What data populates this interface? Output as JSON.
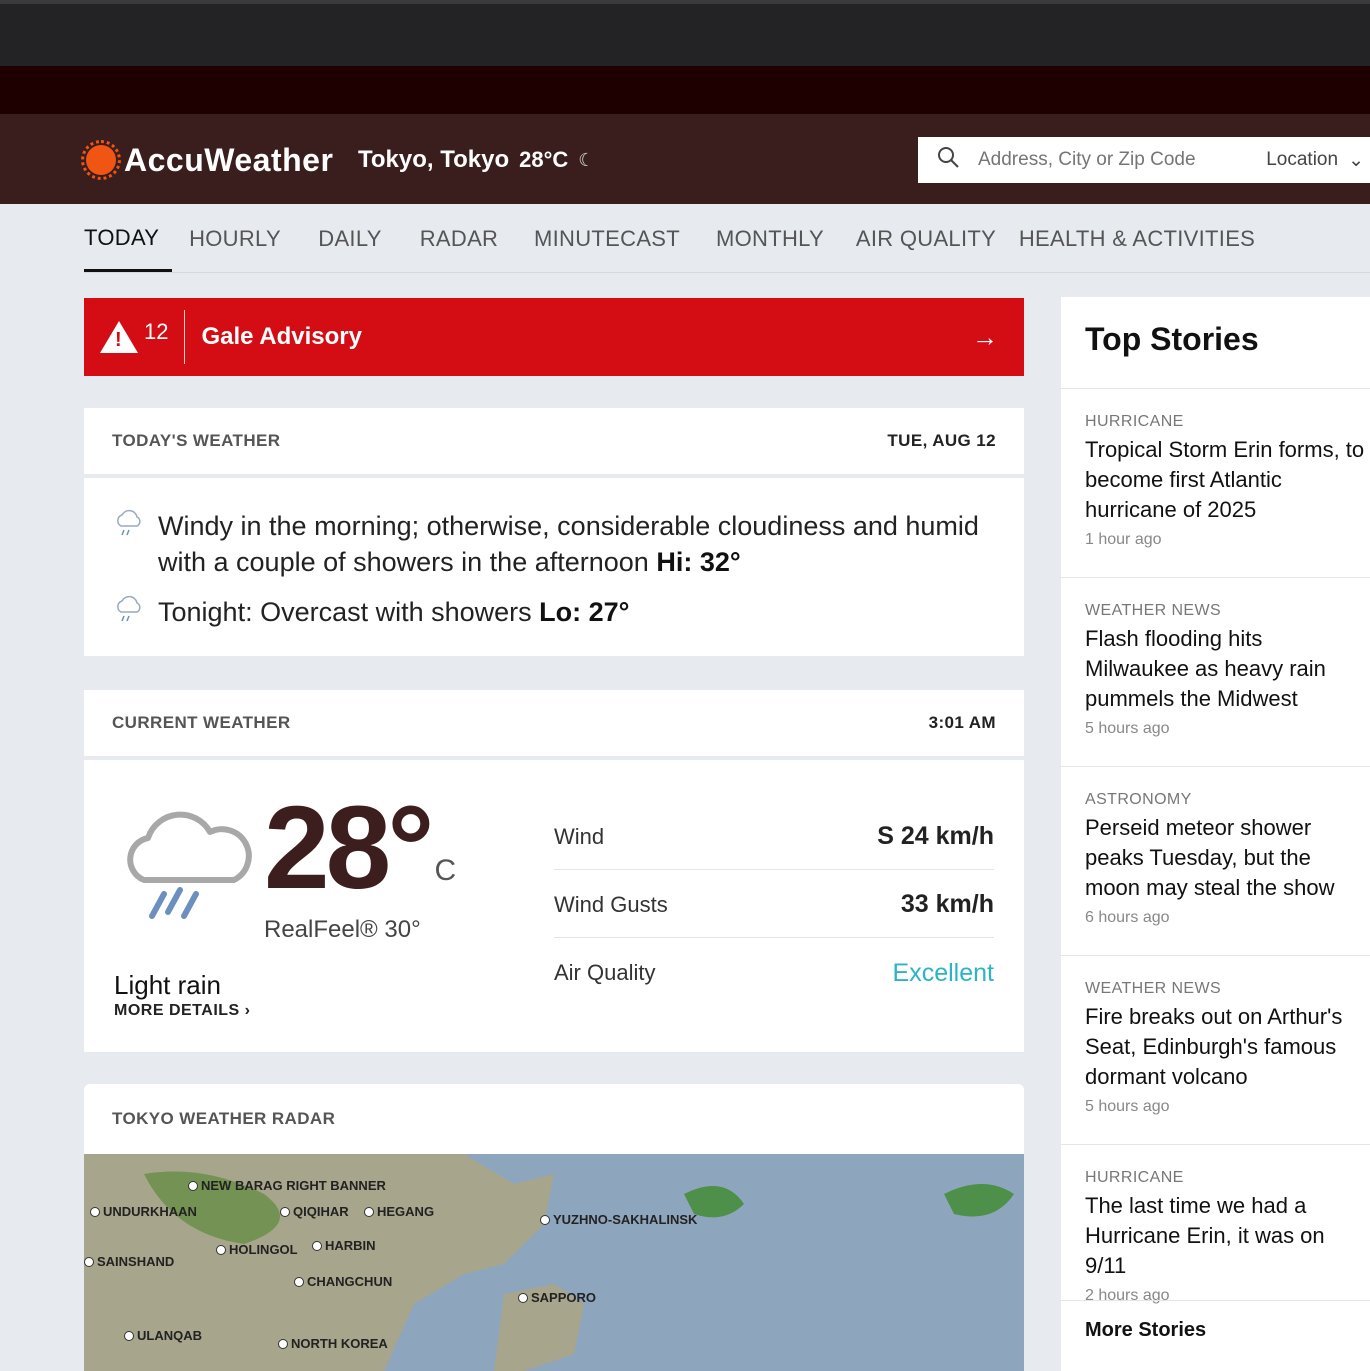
{
  "header": {
    "logo_text": "AccuWeather",
    "location": "Tokyo, Tokyo",
    "location_temp": "28°",
    "location_temp_unit": "C",
    "search_placeholder": "Address, City or Zip Code",
    "location_select": "Location"
  },
  "tabs": [
    {
      "label": "TODAY"
    },
    {
      "label": "HOURLY"
    },
    {
      "label": "DAILY"
    },
    {
      "label": "RADAR"
    },
    {
      "label": "MINUTECAST"
    },
    {
      "label": "MONTHLY"
    },
    {
      "label": "AIR QUALITY"
    },
    {
      "label": "HEALTH & ACTIVITIES"
    }
  ],
  "alert": {
    "count": "12",
    "title": "Gale Advisory"
  },
  "today": {
    "heading": "TODAY'S WEATHER",
    "date": "TUE, AUG 12",
    "day_text": "Windy in the morning; otherwise, considerable cloudiness and humid with a couple of showers in the afternoon",
    "hi_label": "Hi: 32°",
    "night_text": "Tonight: Overcast with showers",
    "lo_label": "Lo: 27°"
  },
  "current": {
    "heading": "CURRENT WEATHER",
    "time": "3:01 AM",
    "temp": "28°",
    "unit": "C",
    "realfeel": "RealFeel® 30°",
    "phrase": "Light rain",
    "more_details": "MORE DETAILS",
    "metrics": [
      {
        "label": "Wind",
        "value": "S 24 km/h"
      },
      {
        "label": "Wind Gusts",
        "value": "33 km/h"
      },
      {
        "label": "Air Quality",
        "value": "Excellent"
      }
    ]
  },
  "radar": {
    "heading": "TOKYO WEATHER RADAR",
    "cities": [
      "NEW BARAG RIGHT BANNER",
      "UNDURKHAAN",
      "QIQIHAR",
      "HEGANG",
      "YUZHNO-SAKHALINSK",
      "HOLINGOL",
      "HARBIN",
      "SAINSHAND",
      "CHANGCHUN",
      "SAPPORO",
      "ULANQAB",
      "NORTH KOREA"
    ]
  },
  "stories": {
    "heading": "Top Stories",
    "items": [
      {
        "category": "HURRICANE",
        "title": "Tropical Storm Erin forms, to become first Atlantic hurricane of 2025",
        "time": "1 hour ago"
      },
      {
        "category": "WEATHER NEWS",
        "title": "Flash flooding hits Milwaukee as heavy rain pummels the Midwest",
        "time": "5 hours ago"
      },
      {
        "category": "ASTRONOMY",
        "title": "Perseid meteor shower peaks Tuesday, but the moon may steal the show",
        "time": "6 hours ago"
      },
      {
        "category": "WEATHER NEWS",
        "title": "Fire breaks out on Arthur's Seat, Edinburgh's famous dormant volcano",
        "time": "5 hours ago"
      },
      {
        "category": "HURRICANE",
        "title": "The last time we had a Hurricane Erin, it was on 9/11",
        "time": "2 hours ago"
      }
    ],
    "more": "More Stories"
  },
  "colors": {
    "alert": "#d40c14",
    "brand": "#f05514",
    "header": "#3a1e1e",
    "air_good": "#2db3c8"
  },
  "icons": [
    "sun-logo-icon",
    "moon-cloud-icon",
    "search-icon",
    "chevron-down-icon",
    "warning-icon",
    "arrow-right-icon",
    "rain-cloud-icon",
    "chevron-right-icon"
  ]
}
